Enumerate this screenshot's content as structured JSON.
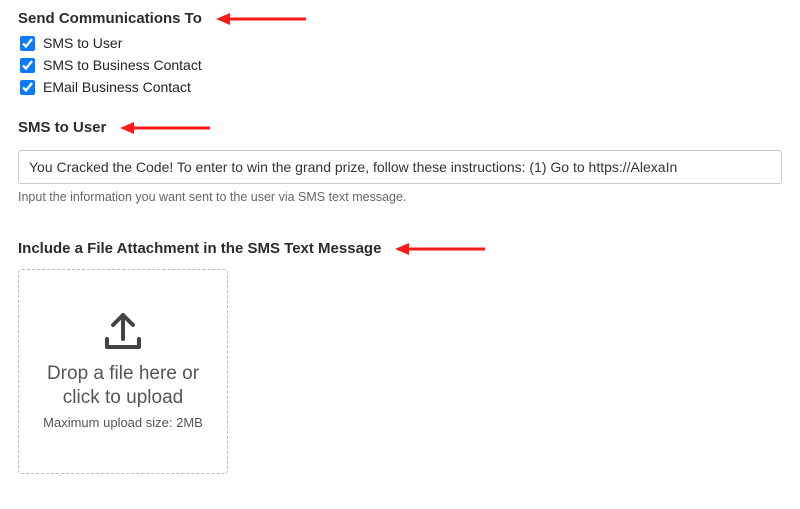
{
  "sections": {
    "sendTo": {
      "title": "Send Communications To",
      "options": [
        {
          "label": "SMS to User",
          "checked": true
        },
        {
          "label": "SMS to Business Contact",
          "checked": true
        },
        {
          "label": "EMail Business Contact",
          "checked": true
        }
      ]
    },
    "smsToUser": {
      "title": "SMS to User",
      "value": "You Cracked the Code! To enter to win the grand prize, follow these instructions: (1) Go to https://AlexaIn",
      "helper": "Input the information you want sent to the user via SMS text message."
    },
    "attachment": {
      "title": "Include a File Attachment in the SMS Text Message",
      "dropMain": "Drop a file here or click to upload",
      "dropSub": "Maximum upload size: 2MB"
    }
  }
}
